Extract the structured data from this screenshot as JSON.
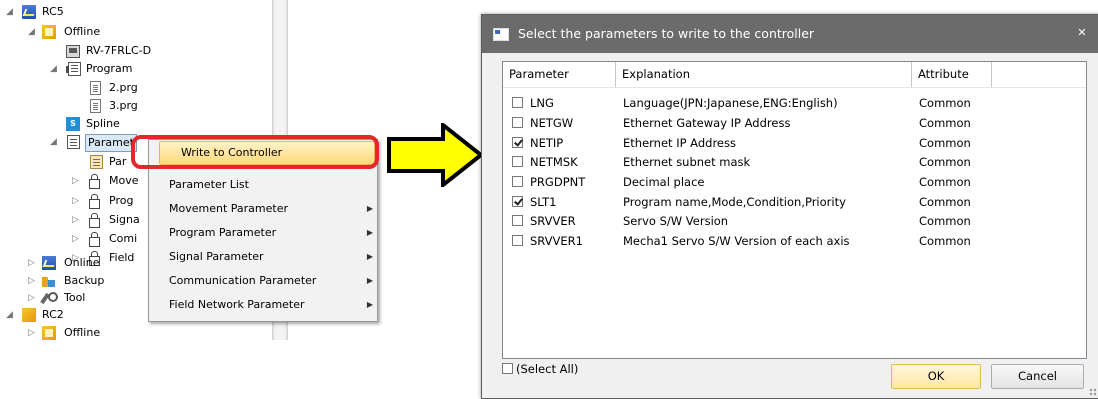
{
  "tree": {
    "nodes": [
      {
        "label": "RC5",
        "toggle": "◢"
      },
      {
        "label": "Offline",
        "toggle": "◢"
      },
      {
        "label": "RV-7FRLC-D",
        "toggle": ""
      },
      {
        "label": "Program",
        "toggle": "◢"
      },
      {
        "label": "2.prg",
        "toggle": ""
      },
      {
        "label": "3.prg",
        "toggle": ""
      },
      {
        "label": "Spline",
        "toggle": ""
      },
      {
        "label": "Paramet",
        "toggle": "◢"
      },
      {
        "label": "Par",
        "toggle": ""
      },
      {
        "label": "Move",
        "toggle": "▷"
      },
      {
        "label": "Prog",
        "toggle": "▷"
      },
      {
        "label": "Signa",
        "toggle": "▷"
      },
      {
        "label": "Comi",
        "toggle": "▷"
      },
      {
        "label": "Field",
        "toggle": "▷"
      },
      {
        "label": "Online",
        "toggle": "▷"
      },
      {
        "label": "Backup",
        "toggle": "▷"
      },
      {
        "label": "Tool",
        "toggle": "▷"
      },
      {
        "label": "RC2",
        "toggle": "◢"
      },
      {
        "label": "Offline",
        "toggle": "▷"
      }
    ]
  },
  "context_menu": {
    "items": [
      {
        "label": "Write to Controller",
        "submenu": false
      },
      {
        "label": "Parameter List",
        "submenu": false
      },
      {
        "label": "Movement Parameter",
        "submenu": true
      },
      {
        "label": "Program Parameter",
        "submenu": true
      },
      {
        "label": "Signal Parameter",
        "submenu": true
      },
      {
        "label": "Communication Parameter",
        "submenu": true
      },
      {
        "label": "Field Network Parameter",
        "submenu": true
      }
    ],
    "arrow_glyph": "▶",
    "highlight_color": "#e3282c"
  },
  "arrow": {
    "fill": "#ffff00",
    "stroke": "#000000"
  },
  "dialog": {
    "title": "Select the parameters to write to the controller",
    "close_glyph": "✕",
    "columns": {
      "parameter": "Parameter",
      "explanation": "Explanation",
      "attribute": "Attribute"
    },
    "rows": [
      {
        "checked": false,
        "parameter": "LNG",
        "explanation": "Language(JPN:Japanese,ENG:English)",
        "attribute": "Common"
      },
      {
        "checked": false,
        "parameter": "NETGW",
        "explanation": "Ethernet Gateway IP Address",
        "attribute": "Common"
      },
      {
        "checked": true,
        "parameter": "NETIP",
        "explanation": "Ethernet IP Address",
        "attribute": "Common"
      },
      {
        "checked": false,
        "parameter": "NETMSK",
        "explanation": "Ethernet subnet mask",
        "attribute": "Common"
      },
      {
        "checked": false,
        "parameter": "PRGDPNT",
        "explanation": "Decimal place",
        "attribute": "Common"
      },
      {
        "checked": true,
        "parameter": "SLT1",
        "explanation": "Program name,Mode,Condition,Priority",
        "attribute": "Common"
      },
      {
        "checked": false,
        "parameter": "SRVVER",
        "explanation": "Servo S/W Version",
        "attribute": "Common"
      },
      {
        "checked": false,
        "parameter": "SRVVER1",
        "explanation": "Mecha1 Servo S/W Version of each axis",
        "attribute": "Common"
      }
    ],
    "select_all_label": "(Select All)",
    "select_all_checked": false,
    "ok_label": "OK",
    "cancel_label": "Cancel"
  }
}
